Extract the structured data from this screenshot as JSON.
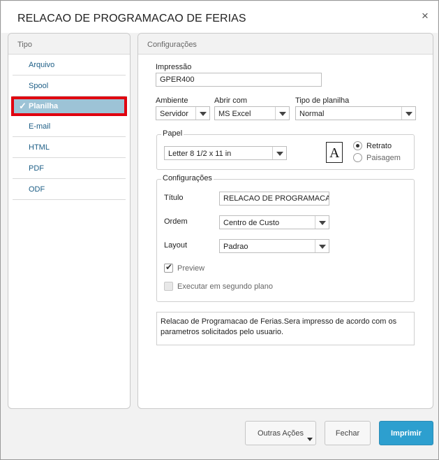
{
  "window": {
    "title": "RELACAO DE PROGRAMACAO DE FERIAS",
    "close_glyph": "×"
  },
  "tipo": {
    "header": "Tipo",
    "items": [
      {
        "label": "Arquivo",
        "selected": false
      },
      {
        "label": "Spool",
        "selected": false
      },
      {
        "label": "Planilha",
        "selected": true
      },
      {
        "label": "E-mail",
        "selected": false
      },
      {
        "label": "HTML",
        "selected": false
      },
      {
        "label": "PDF",
        "selected": false
      },
      {
        "label": "ODF",
        "selected": false
      }
    ],
    "check_glyph": "✓"
  },
  "config": {
    "header": "Configurações",
    "impressao": {
      "label": "Impressão",
      "value": "GPER400"
    },
    "ambiente": {
      "label": "Ambiente",
      "value": "Servidor"
    },
    "abrir_com": {
      "label": "Abrir com",
      "value": "MS Excel"
    },
    "tipo_planilha": {
      "label": "Tipo de planilha",
      "value": "Normal"
    },
    "papel": {
      "legend": "Papel",
      "size": "Letter 8 1/2 x 11 in",
      "orientation_icon": "A",
      "retrato": "Retrato",
      "paisagem": "Paisagem",
      "selected": "Retrato"
    },
    "configuracoes": {
      "legend": "Configurações",
      "titulo": {
        "label": "Título",
        "value": "RELACAO DE PROGRAMACAO"
      },
      "ordem": {
        "label": "Ordem",
        "value": "Centro de Custo"
      },
      "layout": {
        "label": "Layout",
        "value": "Padrao"
      },
      "preview": {
        "label": "Preview",
        "checked": true
      },
      "segundo_plano": {
        "label": "Executar em segundo plano",
        "checked": false,
        "enabled": false
      }
    },
    "description": "Relacao de Programacao de Ferias.Sera impresso de acordo com os parametros solicitados pelo usuario."
  },
  "footer": {
    "outras_acoes": "Outras Ações",
    "fechar": "Fechar",
    "imprimir": "Imprimir"
  },
  "colors": {
    "accent": "#2d9fcf",
    "selected_item_bg": "#9dc3d6",
    "selection_highlight": "#e0000f",
    "link": "#1d5e86"
  }
}
